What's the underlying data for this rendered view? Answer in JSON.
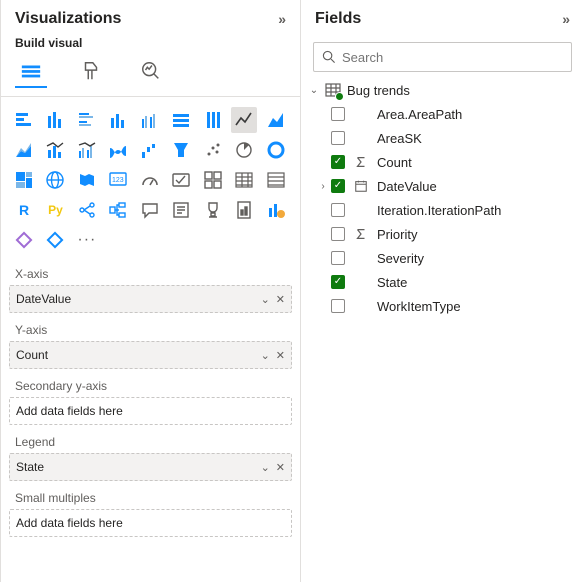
{
  "viz": {
    "title": "Visualizations",
    "subhead": "Build visual",
    "active_tab": "build",
    "viz_icons": [
      [
        "stacked-bar",
        "stacked-bar-h",
        "clustered-bar",
        "stacked-column",
        "clustered-column",
        "100-bar",
        "100-column",
        "line",
        "area"
      ],
      [
        "stacked-area",
        "line-stacked",
        "line-clustered",
        "ribbon",
        "waterfall",
        "funnel",
        "scatter",
        "pie",
        "donut"
      ],
      [
        "treemap",
        "map",
        "filled-map",
        "azure-map",
        "gauge",
        "card",
        "multi-row-card",
        "kpi",
        "slicer"
      ],
      [
        "table",
        "matrix",
        "r",
        "py",
        "key-influencers",
        "decomposition",
        "qa",
        "smart-narrative",
        "paginated"
      ],
      [
        "arcgis",
        "powerapps",
        "powerautomate",
        "more"
      ]
    ],
    "wells": [
      {
        "key": "xaxis",
        "label": "X-axis",
        "value": "DateValue",
        "placeholder": null
      },
      {
        "key": "yaxis",
        "label": "Y-axis",
        "value": "Count",
        "placeholder": null
      },
      {
        "key": "y2",
        "label": "Secondary y-axis",
        "value": null,
        "placeholder": "Add data fields here"
      },
      {
        "key": "legend",
        "label": "Legend",
        "value": "State",
        "placeholder": null
      },
      {
        "key": "smallmult",
        "label": "Small multiples",
        "value": null,
        "placeholder": "Add data fields here"
      }
    ]
  },
  "fields": {
    "title": "Fields",
    "search_placeholder": "Search",
    "table": {
      "name": "Bug trends",
      "expanded": true
    },
    "items": [
      {
        "name": "Area.AreaPath",
        "checked": false,
        "icon": null,
        "expandable": false
      },
      {
        "name": "AreaSK",
        "checked": false,
        "icon": null,
        "expandable": false
      },
      {
        "name": "Count",
        "checked": true,
        "icon": "sigma",
        "expandable": false
      },
      {
        "name": "DateValue",
        "checked": true,
        "icon": "calendar",
        "expandable": true
      },
      {
        "name": "Iteration.IterationPath",
        "checked": false,
        "icon": null,
        "expandable": false
      },
      {
        "name": "Priority",
        "checked": false,
        "icon": "sigma",
        "expandable": false
      },
      {
        "name": "Severity",
        "checked": false,
        "icon": null,
        "expandable": false
      },
      {
        "name": "State",
        "checked": true,
        "icon": null,
        "expandable": false
      },
      {
        "name": "WorkItemType",
        "checked": false,
        "icon": null,
        "expandable": false
      }
    ]
  }
}
